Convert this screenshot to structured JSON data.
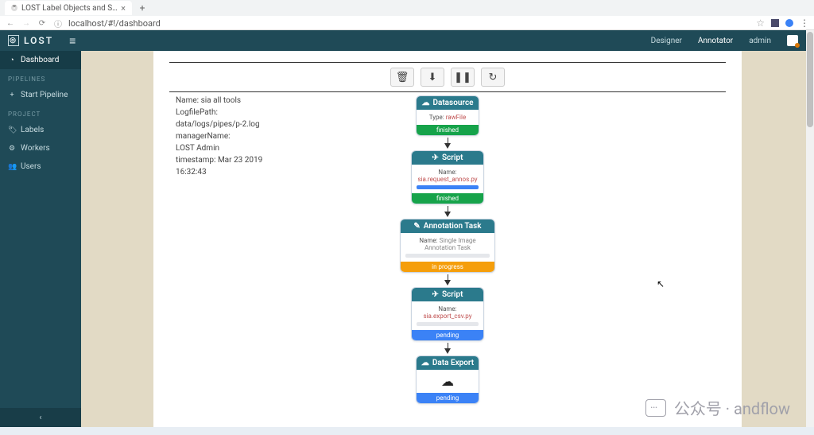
{
  "browser": {
    "tab_title": "LOST Label Objects and S…",
    "url": "localhost/#!/dashboard"
  },
  "topbar": {
    "brand": "LOST",
    "links": {
      "designer": "Designer",
      "annotator": "Annotator",
      "user": "admin"
    }
  },
  "sidebar": {
    "dashboard": "Dashboard",
    "sections": {
      "pipelines": "PIPELINES",
      "project": "PROJECT"
    },
    "items": {
      "start_pipeline": "Start Pipeline",
      "labels": "Labels",
      "workers": "Workers",
      "users": "Users"
    }
  },
  "pipeline_meta": {
    "name_label": "Name:",
    "name_value": "sia all tools",
    "logpath_label": "LogfilePath:",
    "logpath_value": "data/logs/pipes/p-2.log",
    "manager_label": "managerName:",
    "manager_value": "LOST Admin",
    "timestamp_label": "timestamp:",
    "timestamp_value": "Mar 23 2019 16:32:43"
  },
  "nodes": {
    "datasource": {
      "title": "Datasource",
      "type_label": "Type:",
      "type_value": "rawFile",
      "status": "finished"
    },
    "script1": {
      "title": "Script",
      "name_label": "Name:",
      "name_value": "sia.request_annos.py",
      "progress_label": "100%",
      "status": "finished"
    },
    "anno": {
      "title": "Annotation Task",
      "name_label": "Name:",
      "name_value": "Single Image Annotation Task",
      "status": "in progress"
    },
    "script2": {
      "title": "Script",
      "name_label": "Name:",
      "name_value": "sia.export_csv.py",
      "status": "pending"
    },
    "export": {
      "title": "Data Export",
      "status": "pending"
    }
  },
  "watermark": "公众号 · andflow"
}
